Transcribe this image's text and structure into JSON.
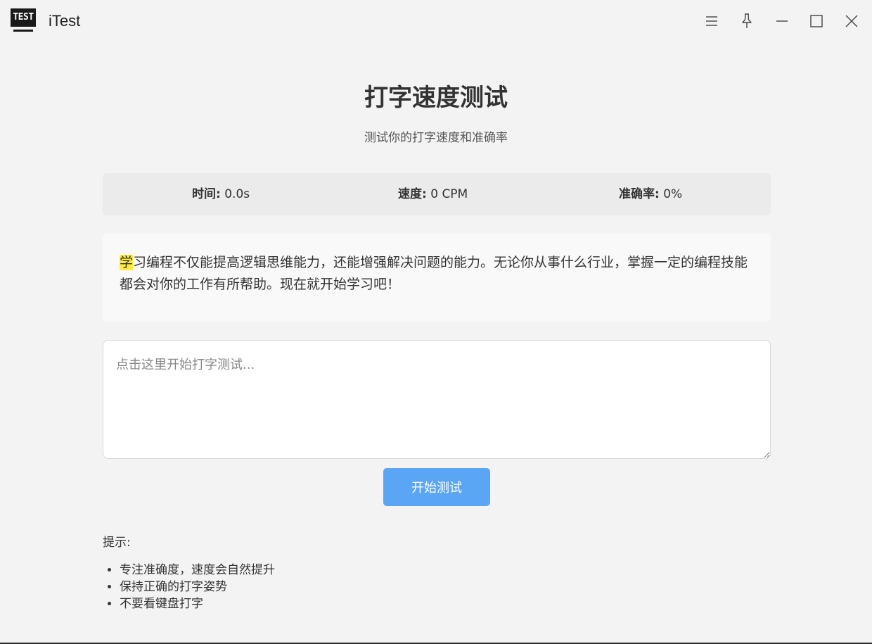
{
  "app": {
    "title": "iTest",
    "logo_text": "TEST"
  },
  "window_controls": {
    "icons": [
      "menu-icon",
      "pin-icon",
      "minimize-icon",
      "maximize-icon",
      "close-icon"
    ]
  },
  "header": {
    "title": "打字速度测试",
    "subtitle": "测试你的打字速度和准确率"
  },
  "stats": {
    "time_label": "时间:",
    "time_value": "0.0s",
    "speed_label": "速度:",
    "speed_value": "0 CPM",
    "accuracy_label": "准确率:",
    "accuracy_value": "0%"
  },
  "passage": {
    "current_char": "学",
    "rest_text": "习编程不仅能提高逻辑思维能力，还能增强解决问题的能力。无论你从事什么行业，掌握一定的编程技能都会对你的工作有所帮助。现在就开始学习吧！"
  },
  "input": {
    "placeholder": "点击这里开始打字测试...",
    "value": ""
  },
  "actions": {
    "start_label": "开始测试"
  },
  "tips": {
    "heading": "提示:",
    "items": [
      "专注准确度，速度会自然提升",
      "保持正确的打字姿势",
      "不要看键盘打字"
    ]
  },
  "colors": {
    "background": "#f3f3f3",
    "accent_button": "#5aa6f5",
    "highlight": "#ffeb3b"
  }
}
